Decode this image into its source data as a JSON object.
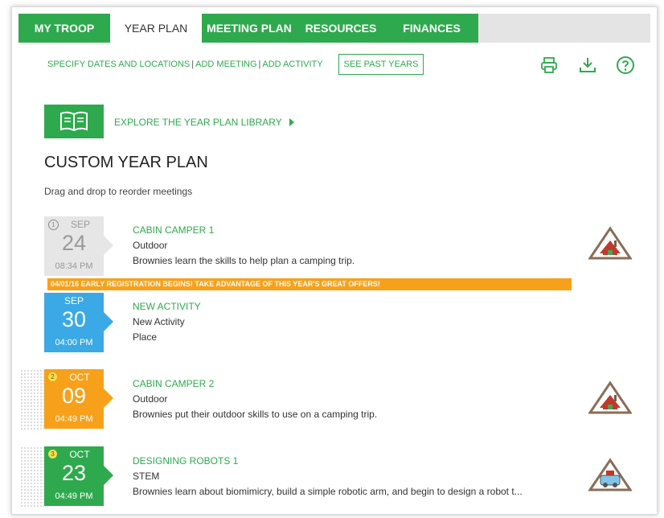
{
  "tabs": [
    {
      "label": "MY TROOP"
    },
    {
      "label": "YEAR PLAN"
    },
    {
      "label": "MEETING PLAN"
    },
    {
      "label": "RESOURCES"
    },
    {
      "label": "FINANCES"
    }
  ],
  "toolbar": {
    "specify": "SPECIFY DATES AND LOCATIONS",
    "add_meeting": "ADD MEETING",
    "add_activity": "ADD ACTIVITY",
    "separator": "|",
    "past_years": "SEE PAST YEARS"
  },
  "icons": {
    "print": "printer-icon",
    "download": "download-icon",
    "help": "help-icon",
    "book": "book-icon",
    "arrow": "play-arrow-icon"
  },
  "explore": {
    "label": "EXPLORE THE YEAR PLAN LIBRARY"
  },
  "page_title": "CUSTOM YEAR PLAN",
  "subtitle": "Drag and drop to reorder meetings",
  "announcement": "04/01/16 EARLY REGISTRATION BEGINS! TAKE ADVANTAGE OF THIS YEAR'S GREAT OFFERS!",
  "colors": {
    "green": "#2fa94e",
    "blue": "#3aa9e5",
    "orange": "#f7a11a",
    "past_gray": "#e6e6e6"
  },
  "meetings": [
    {
      "num": "1",
      "month": "SEP",
      "day": "24",
      "time": "08:34 PM",
      "title": "CABIN CAMPER 1",
      "category": "Outdoor",
      "description": "Brownies learn the skills to help plan a camping trip.",
      "badge": "cabin-badge-icon"
    },
    {
      "num": "",
      "month": "SEP",
      "day": "30",
      "time": "04:00 PM",
      "title": "NEW ACTIVITY",
      "category": "New Activity",
      "description": "Place",
      "badge": ""
    },
    {
      "num": "2",
      "month": "OCT",
      "day": "09",
      "time": "04:49 PM",
      "title": "CABIN CAMPER 2",
      "category": "Outdoor",
      "description": "Brownies put their outdoor skills to use on a camping trip.",
      "badge": "cabin-badge-icon"
    },
    {
      "num": "3",
      "month": "OCT",
      "day": "23",
      "time": "04:49 PM",
      "title": "DESIGNING ROBOTS 1",
      "category": "STEM",
      "description": "Brownies learn about biomimicry, build a simple robotic arm, and begin to design a robot t...",
      "badge": "robot-badge-icon"
    }
  ]
}
